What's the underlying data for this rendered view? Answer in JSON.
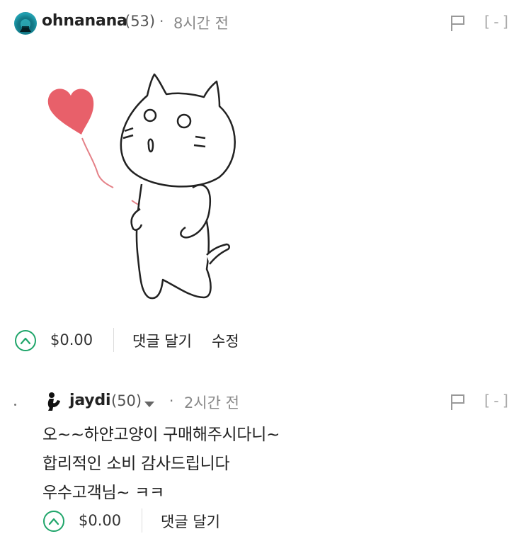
{
  "comment": {
    "author": "ohnanana",
    "reputation": "(53)",
    "separator": "·",
    "time": "8시간 전",
    "collapse": "[-]",
    "payout": "$0.00",
    "reply_label": "댓글 달기",
    "edit_label": "수정"
  },
  "reply": {
    "author": "jaydi",
    "reputation": "(50)",
    "separator": "·",
    "time": "2시간 전",
    "collapse": "[-]",
    "body": [
      "오~~하얀고양이 구매해주시다니~",
      "합리적인 소비 감사드립니다",
      "우수고객님~ ㅋㅋ"
    ],
    "payout": "$0.00",
    "reply_label": "댓글 달기"
  },
  "colors": {
    "upvote": "#1fa56a",
    "heart": "#e8606a"
  }
}
